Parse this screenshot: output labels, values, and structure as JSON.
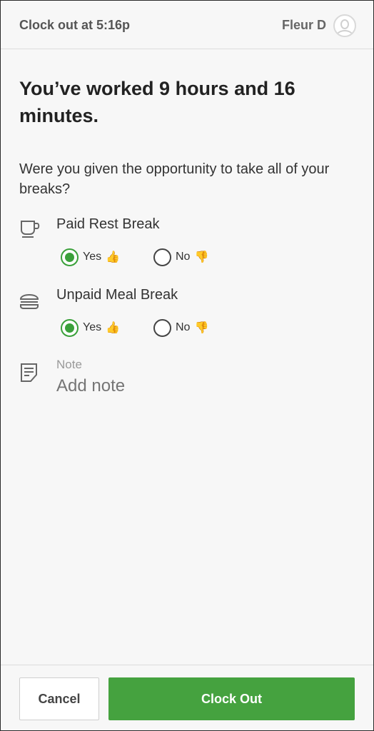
{
  "header": {
    "title": "Clock out at 5:16p",
    "user_name": "Fleur D"
  },
  "main": {
    "headline": "You’ve worked 9 hours and 16 minutes.",
    "question": "Were you given the opportunity to take all of your breaks?",
    "breaks": [
      {
        "label": "Paid Rest Break",
        "icon": "cup-icon",
        "yes_label": "Yes",
        "no_label": "No",
        "selected": "Yes"
      },
      {
        "label": "Unpaid Meal Break",
        "icon": "burger-icon",
        "yes_label": "Yes",
        "no_label": "No",
        "selected": "Yes"
      }
    ],
    "note": {
      "label": "Note",
      "placeholder": "Add note"
    }
  },
  "footer": {
    "cancel_label": "Cancel",
    "primary_label": "Clock Out"
  },
  "colors": {
    "accent": "#45a23f",
    "radio_checked": "#3aa03a"
  }
}
